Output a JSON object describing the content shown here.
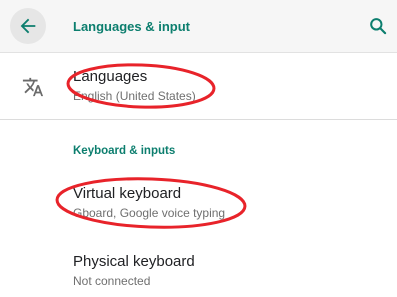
{
  "header": {
    "title": "Languages & input",
    "back_icon": "arrow-back-icon",
    "search_icon": "search-icon"
  },
  "languages_row": {
    "icon": "translate-icon",
    "title": "Languages",
    "summary": "English (United States)"
  },
  "keyboard_section": {
    "header": "Keyboard & inputs",
    "virtual_keyboard": {
      "title": "Virtual keyboard",
      "summary": "Gboard, Google voice typing"
    },
    "physical_keyboard": {
      "title": "Physical keyboard",
      "summary": "Not connected"
    }
  },
  "colors": {
    "accent": "#0c7e6e",
    "annotation": "#e8232a"
  }
}
